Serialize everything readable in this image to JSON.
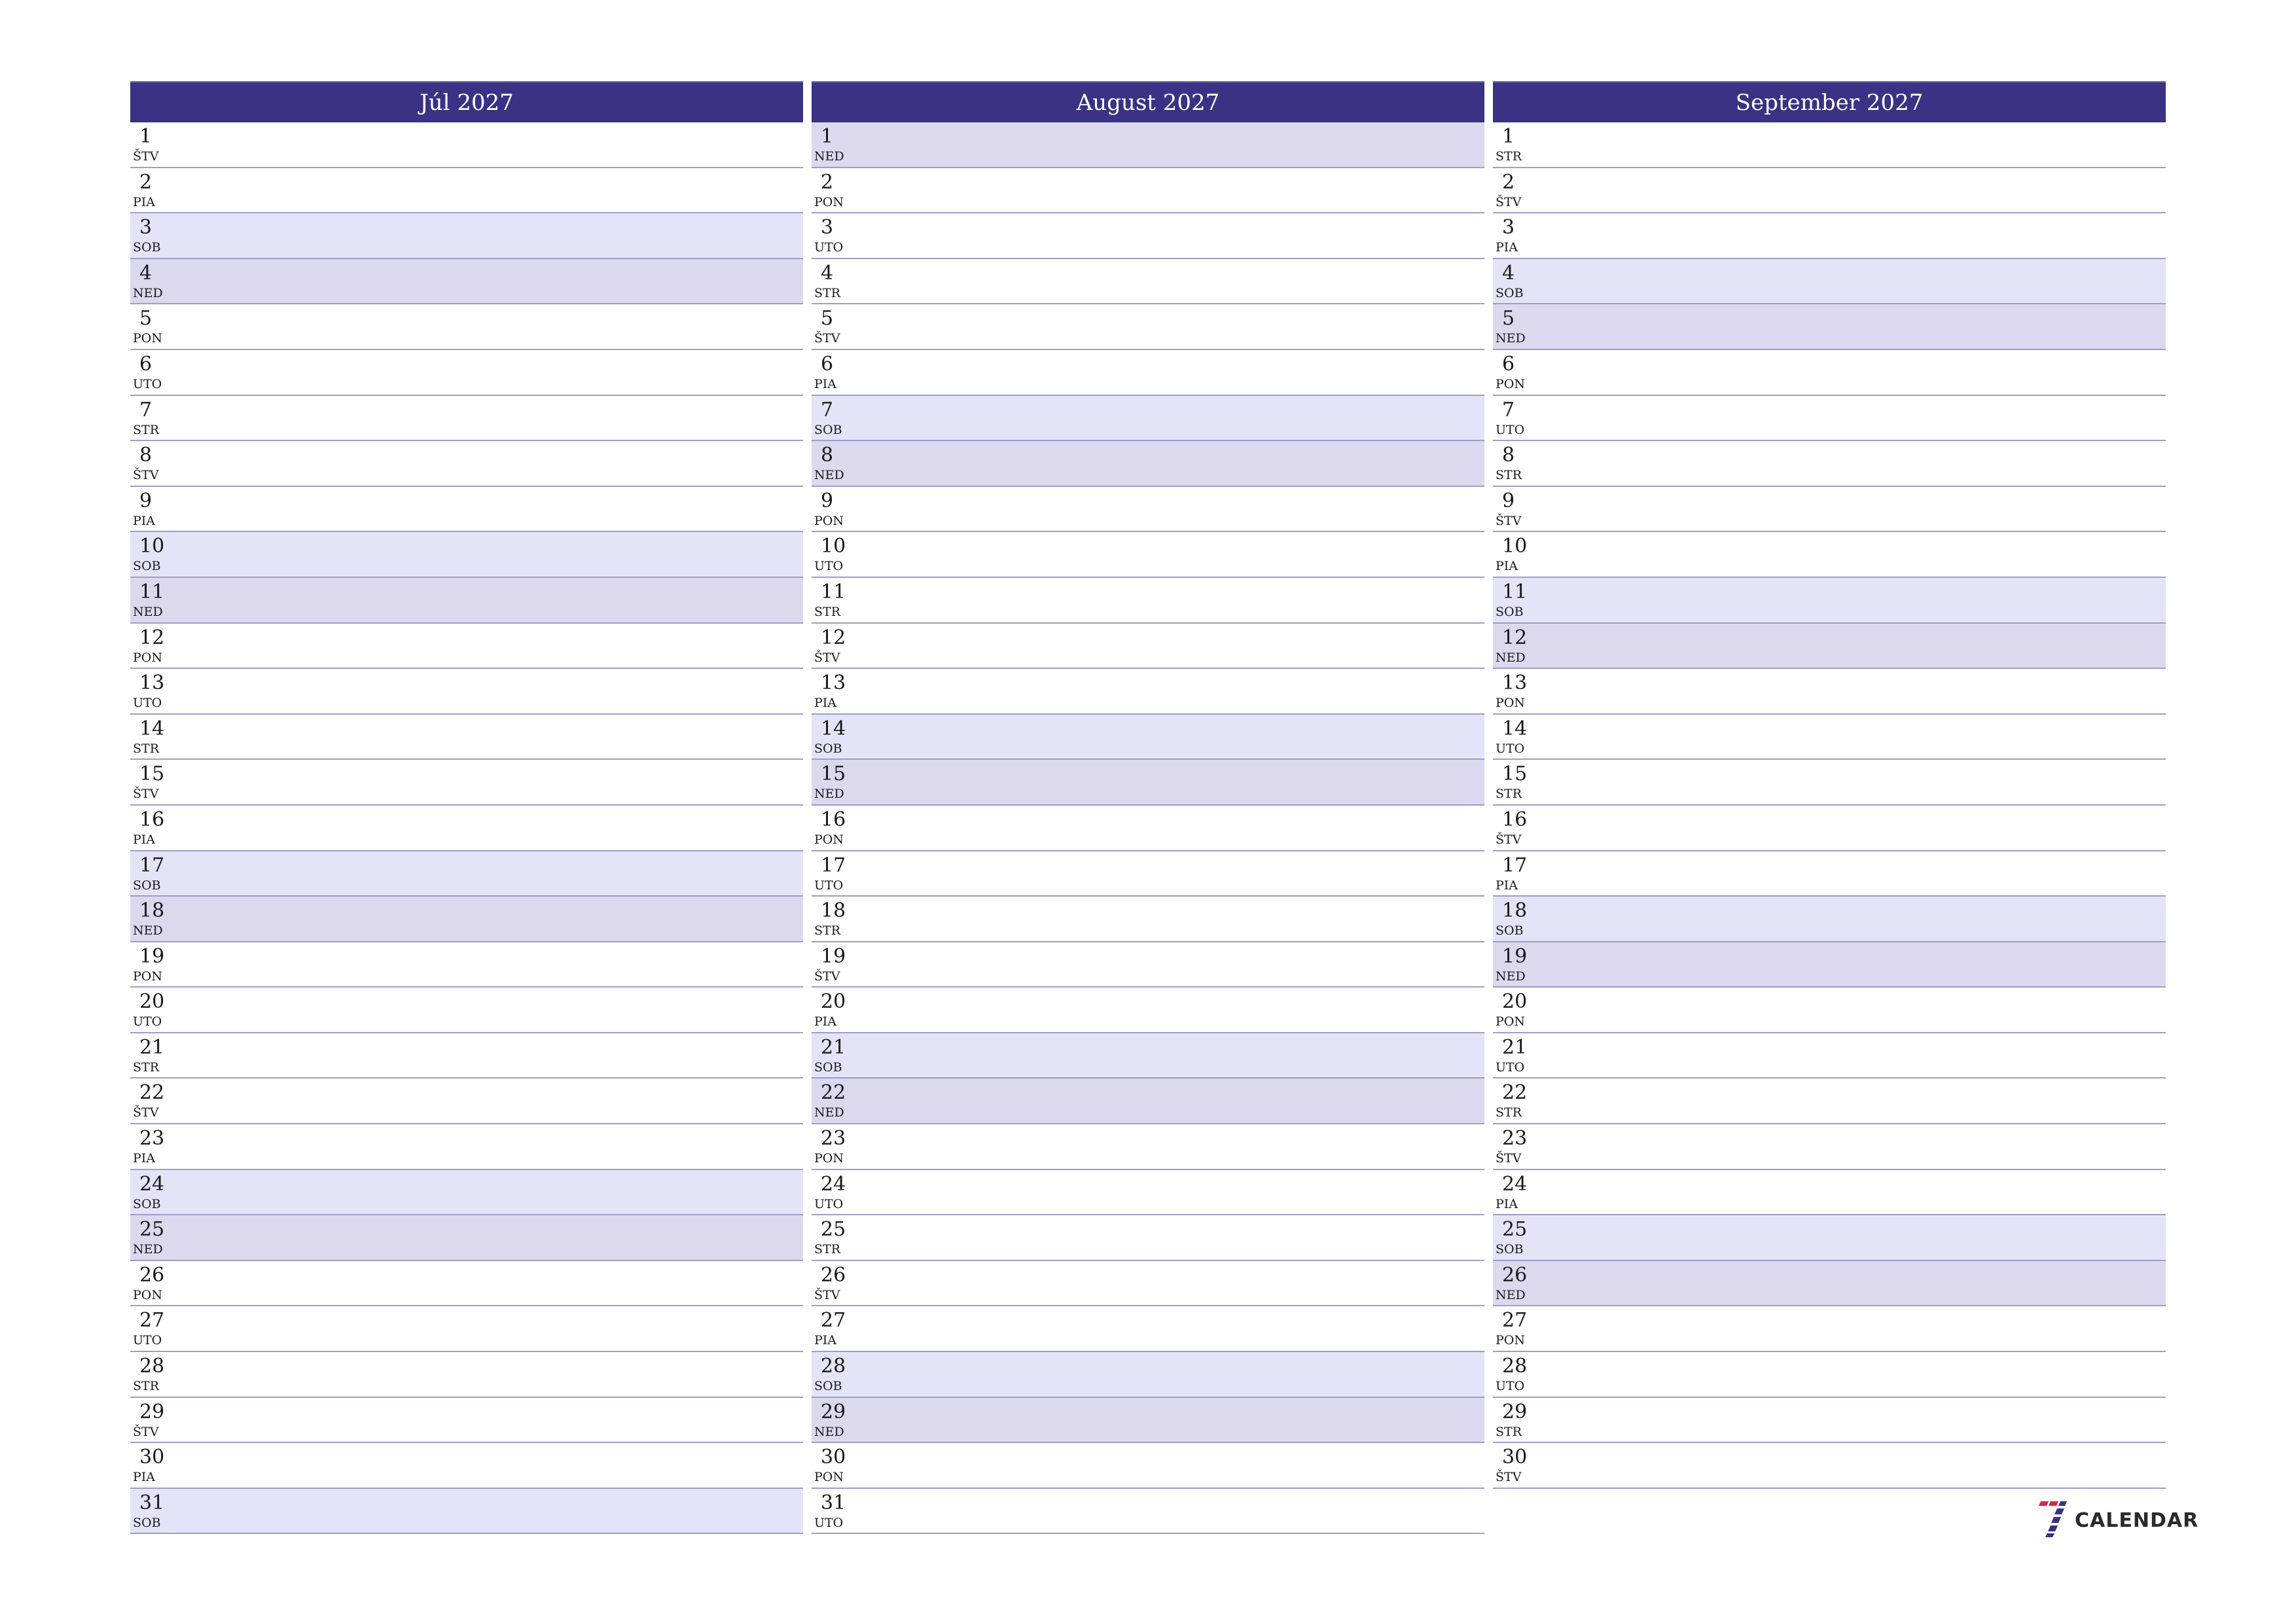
{
  "colors": {
    "header_bg": "#3a3284",
    "saturday_bg": "#e4e4f8",
    "sunday_bg": "#dcd8ee",
    "row_border": "#a09cc9",
    "logo_red": "#e8204a",
    "logo_blue": "#3a3284"
  },
  "months": [
    {
      "title": "Júl 2027",
      "days": [
        {
          "num": "1",
          "name": "ŠTV"
        },
        {
          "num": "2",
          "name": "PIA"
        },
        {
          "num": "3",
          "name": "SOB"
        },
        {
          "num": "4",
          "name": "NED"
        },
        {
          "num": "5",
          "name": "PON"
        },
        {
          "num": "6",
          "name": "UTO"
        },
        {
          "num": "7",
          "name": "STR"
        },
        {
          "num": "8",
          "name": "ŠTV"
        },
        {
          "num": "9",
          "name": "PIA"
        },
        {
          "num": "10",
          "name": "SOB"
        },
        {
          "num": "11",
          "name": "NED"
        },
        {
          "num": "12",
          "name": "PON"
        },
        {
          "num": "13",
          "name": "UTO"
        },
        {
          "num": "14",
          "name": "STR"
        },
        {
          "num": "15",
          "name": "ŠTV"
        },
        {
          "num": "16",
          "name": "PIA"
        },
        {
          "num": "17",
          "name": "SOB"
        },
        {
          "num": "18",
          "name": "NED"
        },
        {
          "num": "19",
          "name": "PON"
        },
        {
          "num": "20",
          "name": "UTO"
        },
        {
          "num": "21",
          "name": "STR"
        },
        {
          "num": "22",
          "name": "ŠTV"
        },
        {
          "num": "23",
          "name": "PIA"
        },
        {
          "num": "24",
          "name": "SOB"
        },
        {
          "num": "25",
          "name": "NED"
        },
        {
          "num": "26",
          "name": "PON"
        },
        {
          "num": "27",
          "name": "UTO"
        },
        {
          "num": "28",
          "name": "STR"
        },
        {
          "num": "29",
          "name": "ŠTV"
        },
        {
          "num": "30",
          "name": "PIA"
        },
        {
          "num": "31",
          "name": "SOB"
        }
      ]
    },
    {
      "title": "August 2027",
      "days": [
        {
          "num": "1",
          "name": "NED"
        },
        {
          "num": "2",
          "name": "PON"
        },
        {
          "num": "3",
          "name": "UTO"
        },
        {
          "num": "4",
          "name": "STR"
        },
        {
          "num": "5",
          "name": "ŠTV"
        },
        {
          "num": "6",
          "name": "PIA"
        },
        {
          "num": "7",
          "name": "SOB"
        },
        {
          "num": "8",
          "name": "NED"
        },
        {
          "num": "9",
          "name": "PON"
        },
        {
          "num": "10",
          "name": "UTO"
        },
        {
          "num": "11",
          "name": "STR"
        },
        {
          "num": "12",
          "name": "ŠTV"
        },
        {
          "num": "13",
          "name": "PIA"
        },
        {
          "num": "14",
          "name": "SOB"
        },
        {
          "num": "15",
          "name": "NED"
        },
        {
          "num": "16",
          "name": "PON"
        },
        {
          "num": "17",
          "name": "UTO"
        },
        {
          "num": "18",
          "name": "STR"
        },
        {
          "num": "19",
          "name": "ŠTV"
        },
        {
          "num": "20",
          "name": "PIA"
        },
        {
          "num": "21",
          "name": "SOB"
        },
        {
          "num": "22",
          "name": "NED"
        },
        {
          "num": "23",
          "name": "PON"
        },
        {
          "num": "24",
          "name": "UTO"
        },
        {
          "num": "25",
          "name": "STR"
        },
        {
          "num": "26",
          "name": "ŠTV"
        },
        {
          "num": "27",
          "name": "PIA"
        },
        {
          "num": "28",
          "name": "SOB"
        },
        {
          "num": "29",
          "name": "NED"
        },
        {
          "num": "30",
          "name": "PON"
        },
        {
          "num": "31",
          "name": "UTO"
        }
      ]
    },
    {
      "title": "September 2027",
      "days": [
        {
          "num": "1",
          "name": "STR"
        },
        {
          "num": "2",
          "name": "ŠTV"
        },
        {
          "num": "3",
          "name": "PIA"
        },
        {
          "num": "4",
          "name": "SOB"
        },
        {
          "num": "5",
          "name": "NED"
        },
        {
          "num": "6",
          "name": "PON"
        },
        {
          "num": "7",
          "name": "UTO"
        },
        {
          "num": "8",
          "name": "STR"
        },
        {
          "num": "9",
          "name": "ŠTV"
        },
        {
          "num": "10",
          "name": "PIA"
        },
        {
          "num": "11",
          "name": "SOB"
        },
        {
          "num": "12",
          "name": "NED"
        },
        {
          "num": "13",
          "name": "PON"
        },
        {
          "num": "14",
          "name": "UTO"
        },
        {
          "num": "15",
          "name": "STR"
        },
        {
          "num": "16",
          "name": "ŠTV"
        },
        {
          "num": "17",
          "name": "PIA"
        },
        {
          "num": "18",
          "name": "SOB"
        },
        {
          "num": "19",
          "name": "NED"
        },
        {
          "num": "20",
          "name": "PON"
        },
        {
          "num": "21",
          "name": "UTO"
        },
        {
          "num": "22",
          "name": "STR"
        },
        {
          "num": "23",
          "name": "ŠTV"
        },
        {
          "num": "24",
          "name": "PIA"
        },
        {
          "num": "25",
          "name": "SOB"
        },
        {
          "num": "26",
          "name": "NED"
        },
        {
          "num": "27",
          "name": "PON"
        },
        {
          "num": "28",
          "name": "UTO"
        },
        {
          "num": "29",
          "name": "STR"
        },
        {
          "num": "30",
          "name": "ŠTV"
        }
      ]
    }
  ],
  "weekend": {
    "saturday": "SOB",
    "sunday": "NED"
  },
  "logo": {
    "icon": "seven-calendar-logo-icon",
    "text": "CALENDAR"
  }
}
